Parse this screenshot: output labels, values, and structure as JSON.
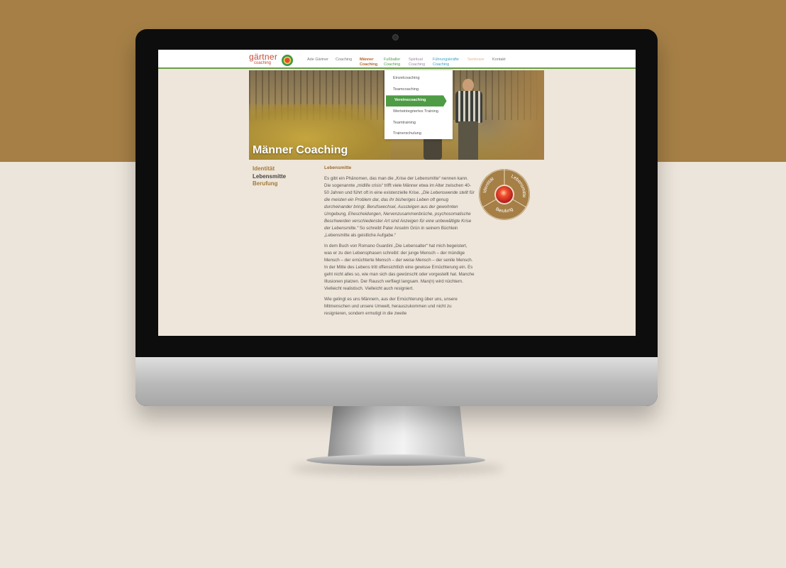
{
  "site": {
    "logo": {
      "main": "gärtner",
      "sub": "coaching"
    },
    "nav": [
      {
        "l1": "Ade Gärtner",
        "l2": "",
        "color": "#777777"
      },
      {
        "l1": "Coaching",
        "l2": "",
        "color": "#777777"
      },
      {
        "l1": "Männer",
        "l2": "Coaching",
        "color": "#b5632a"
      },
      {
        "l1": "Fußballer",
        "l2": "Coaching",
        "color": "#4e9c45"
      },
      {
        "l1": "Spiritual",
        "l2": "Coaching",
        "color": "#9a86a8"
      },
      {
        "l1": "Führungskräfte",
        "l2": "Coaching",
        "color": "#3aa0c0"
      },
      {
        "l1": "Seminare",
        "l2": "",
        "color": "#e8b48a"
      },
      {
        "l1": "Kontakt",
        "l2": "",
        "color": "#777777"
      }
    ],
    "dropdown": [
      {
        "label": "Einzelcoaching",
        "active": false
      },
      {
        "label": "Teamcoaching",
        "active": false
      },
      {
        "label": "Vereinscoaching",
        "active": true
      },
      {
        "label": "Werteintegriertes Training",
        "active": false
      },
      {
        "label": "Teamtraining",
        "active": false
      },
      {
        "label": "Trainerschulung",
        "active": false
      }
    ],
    "hero_title": "Männer Coaching",
    "subnav": [
      {
        "label": "Identität",
        "color": "#a37a3c"
      },
      {
        "label": "Lebensmitte",
        "color": "#444444"
      },
      {
        "label": "Berufung",
        "color": "#a37a3c"
      }
    ],
    "content": {
      "heading": "Lebensmitte",
      "p1_a": "Es gibt ein Phänomen, das man die „Krise der Lebensmitte“ nennen kann. Die sogenannte „midlife crisis“ trifft viele Männer etwa im Alter zwischen 40-50 Jahren und führt oft in eine existenzielle Krise. ",
      "p1_em": "„Die Lebenswende stellt für die meisten ein Problem dar, das ihr bisheriges Leben oft genug durcheinander bringt. Berufswechsel, Aussteigen aus der gewohnten Umgebung, Ehescheidungen, Nervenzusammenbrüche, psychosomatische Beschwerden verschiedenster Art sind Anzeigen für eine unbewältigte Krise der Lebensmitte.“",
      "p1_b": " So schreibt Pater Anselm Grün in seinem Büchlein „Lebensmitte als geistliche Aufgabe.“",
      "p2": "In dem Buch von Romano Guardini „Die Lebensalter“ hat mich begeistert, was er zu den Lebensphasen schreibt: der junge Mensch – der mündige Mensch – der ernüchterte Mensch – der weise Mensch – der senile Mensch. In der Mitte des Lebens tritt offensichtlich eine gewisse Ernüchterung ein. Es geht nicht alles so, wie man sich das gewünscht oder vorgestellt hat. Manche Illusionen platzen. Der Rausch verfliegt langsam. Man(n) wird nüchtern. Vielleicht realistisch. Vielleicht auch resigniert.",
      "p3": "Wie gelingt es uns Männern, aus der Ernüchterung über uns, unsere Mitmenschen und unsere Umwelt, herauszukommen und nicht zu resignieren, sondern ermutigt in die zweite"
    },
    "wheel": {
      "segments": [
        "Identität",
        "Lebensmitte",
        "Berufung"
      ],
      "color": "#a57f46"
    }
  }
}
